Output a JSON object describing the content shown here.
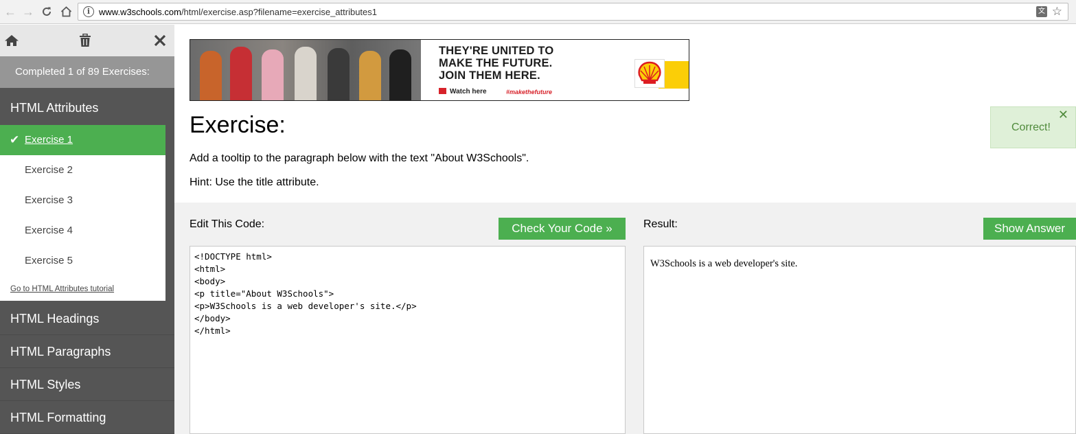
{
  "browser": {
    "url_host": "www.w3schools.com",
    "url_path": "/html/exercise.asp?filename=exercise_attributes1",
    "icons": [
      "back-arrow-icon",
      "forward-arrow-icon",
      "reload-icon",
      "home-icon",
      "info-icon",
      "translate-icon",
      "star-icon"
    ]
  },
  "sidebar": {
    "completed_text": "Completed 1 of 89 Exercises:",
    "section_title": "HTML Attributes",
    "exercises": [
      {
        "label": "Exercise 1",
        "active": true
      },
      {
        "label": "Exercise 2",
        "active": false
      },
      {
        "label": "Exercise 3",
        "active": false
      },
      {
        "label": "Exercise 4",
        "active": false
      },
      {
        "label": "Exercise 5",
        "active": false
      }
    ],
    "tutorial_link": "Go to HTML Attributes tutorial",
    "categories": [
      "HTML Headings",
      "HTML Paragraphs",
      "HTML Styles",
      "HTML Formatting"
    ],
    "accent_color": "#4caf50"
  },
  "ad": {
    "line1": "THEY'RE UNITED TO",
    "line2": "MAKE THE FUTURE.",
    "line3": "JOIN THEM HERE.",
    "watch": "Watch here",
    "hashtag": "#makethefuture"
  },
  "main": {
    "heading": "Exercise:",
    "instruction": "Add a tooltip to the paragraph below with the text \"About W3Schools\".",
    "hint": "Hint: Use the title attribute.",
    "edit_label": "Edit This Code:",
    "result_label": "Result:",
    "check_button": "Check Your Code »",
    "answer_button": "Show Answer",
    "correct_message": "Correct!",
    "code_lines": [
      "<!DOCTYPE html>",
      "<html>",
      "<body>",
      "<p title=\"About W3Schools\">",
      "<p>W3Schools is a web developer's site.</p>",
      "</body>",
      "</html>"
    ],
    "result_text": "W3Schools is a web developer's site."
  }
}
